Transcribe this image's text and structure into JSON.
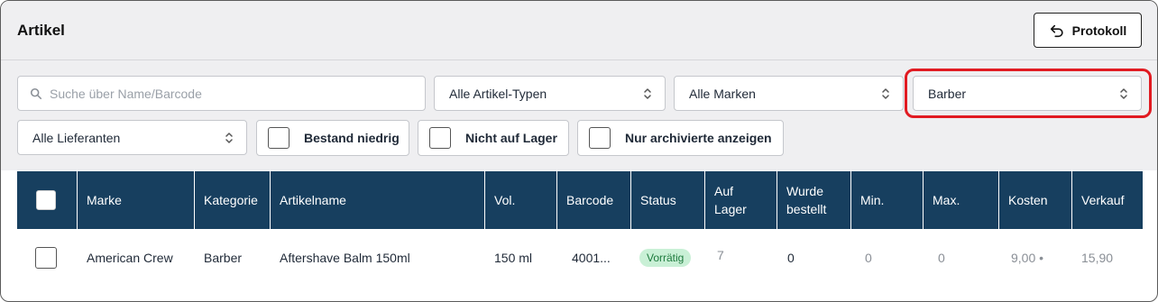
{
  "header": {
    "title": "Artikel",
    "protokoll_label": "Protokoll",
    "protokoll_icon": "undo-arrow-icon"
  },
  "filters": {
    "search_placeholder": "Suche über Name/Barcode",
    "search_icon": "search-icon",
    "article_type": "Alle Artikel-Typen",
    "brand": "Alle Marken",
    "category": "Barber",
    "supplier": "Alle Lieferanten",
    "low_stock_label": "Bestand niedrig",
    "out_of_stock_label": "Nicht auf Lager",
    "archived_label": "Nur archivierte anzeigen",
    "highlight_color": "#e11b22"
  },
  "table": {
    "header_color": "#173f5f",
    "columns": {
      "brand": "Marke",
      "category": "Kategorie",
      "name": "Artikelname",
      "volume": "Vol.",
      "barcode": "Barcode",
      "status": "Status",
      "in_stock_l1": "Auf",
      "in_stock_l2": "Lager",
      "ordered_l1": "Wurde",
      "ordered_l2": "bestellt",
      "min": "Min.",
      "max": "Max.",
      "cost": "Kosten",
      "sale": "Verkauf"
    },
    "rows": [
      {
        "brand": "American Crew",
        "category": "Barber",
        "name": "Aftershave Balm 150ml",
        "volume": "150 ml",
        "barcode": "4001...",
        "status": "Vorrätig",
        "in_stock": "7",
        "ordered": "0",
        "min": "0",
        "max": "0",
        "cost": "9,00 •",
        "sale": "15,90"
      }
    ]
  }
}
